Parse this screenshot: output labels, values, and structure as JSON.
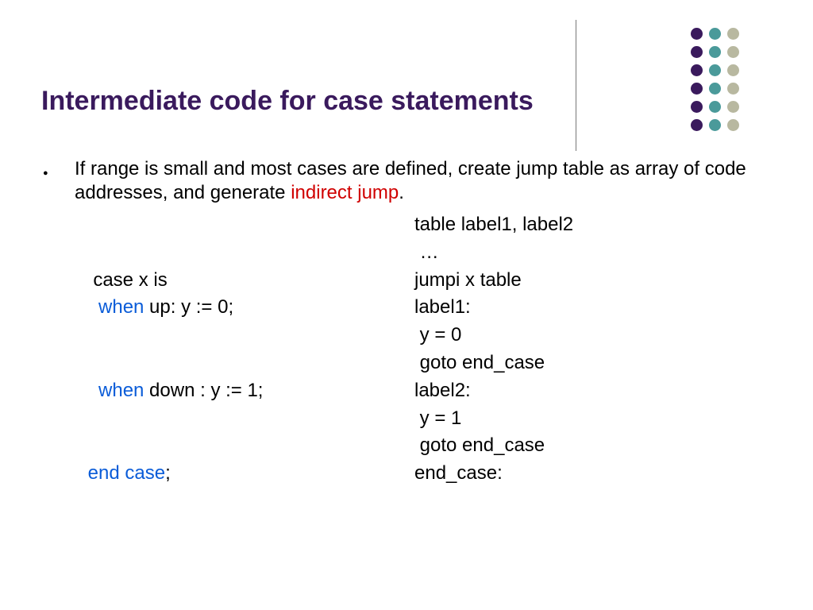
{
  "title": "Intermediate code for case statements",
  "bullet": {
    "pre": "If range is small and most cases are defined, create jump table as array of code addresses,  and generate ",
    "hl": "indirect jump",
    "post": "."
  },
  "code": {
    "r0_L": "",
    "r0_R": "table label1, label2",
    "r1_L": "",
    "r1_R": " …",
    "r2_L": "  case x is",
    "r2_R": "jumpi x table",
    "r3_La": "   ",
    "r3_Lkw": "when",
    "r3_Lb": " up: y := 0;",
    "r3_R": "label1:",
    "r4_L": "",
    "r4_R": " y = 0",
    "r5_L": "",
    "r5_R": " goto end_case",
    "r6_La": "   ",
    "r6_Lkw": "when",
    "r6_Lb": " down : y := 1;",
    "r6_R": "label2:",
    "r7_L": "",
    "r7_R": " y = 1",
    "r8_L": "",
    "r8_R": " goto end_case",
    "r9_La": " ",
    "r9_Lkw": "end case",
    "r9_Lb": ";",
    "r9_R": "end_case:"
  }
}
